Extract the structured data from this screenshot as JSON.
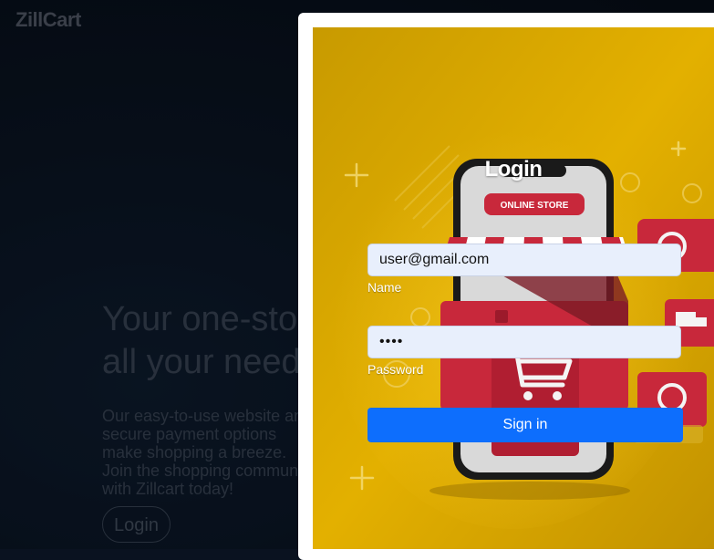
{
  "brand": {
    "name": "ZillCart"
  },
  "hero": {
    "title": "Your one-stop shop for all your needs.",
    "description": "Our easy-to-use website and secure payment options make shopping a breeze. Join the shopping community with Zillcart today!",
    "login_label": "Login"
  },
  "modal": {
    "title": "Login",
    "email_value": "user@gmail.com",
    "email_label": "Name",
    "password_value": "••••",
    "password_label": "Password",
    "submit_label": "Sign in",
    "art": {
      "badge_text": "ONLINE STORE"
    }
  },
  "colors": {
    "accent": "#0d6efd",
    "modal_bg": "#d6a600",
    "phone_red": "#c8283b"
  }
}
